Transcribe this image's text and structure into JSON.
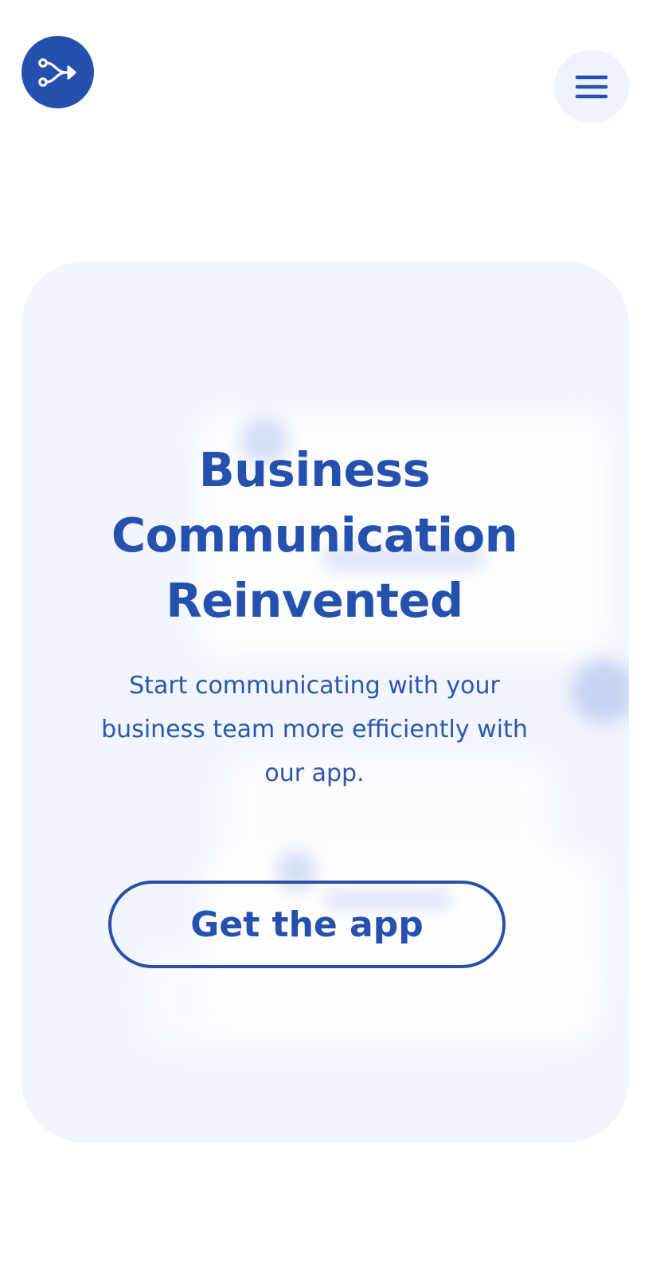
{
  "header": {
    "logo_icon": "branch-arrow-icon",
    "menu_icon": "hamburger-menu-icon"
  },
  "hero": {
    "title_lines": [
      "Business",
      "Communication",
      "Reinvented"
    ],
    "subtitle": "Start communicating with your business team more efficiently with our app.",
    "cta_label": "Get the app"
  },
  "colors": {
    "brand": "#2550b0",
    "hero_background": "#f1f5fd",
    "menu_button_background": "#eef3fd",
    "text": "#2650ad"
  }
}
